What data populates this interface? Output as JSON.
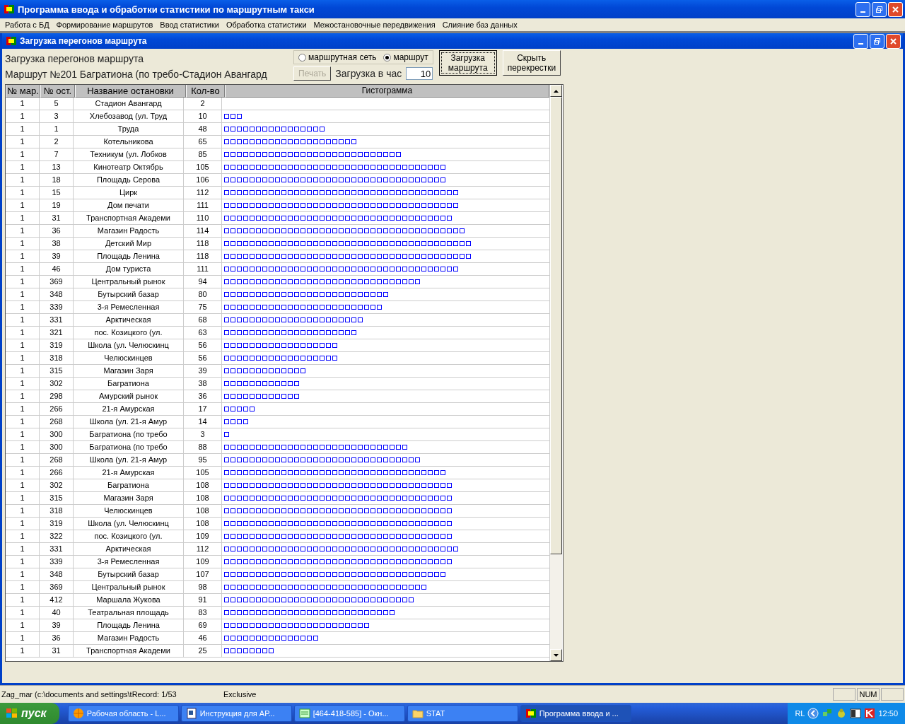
{
  "window": {
    "title": "Программа ввода и обработки статистики по маршрутным такси"
  },
  "menu": [
    "Работа с БД",
    "Формирование маршрутов",
    "Ввод статистики",
    "Обработка статистики",
    "Межостановочные передвижения",
    "Слияние баз данных"
  ],
  "child_window": {
    "title": "Загрузка перегонов маршрута"
  },
  "panel": {
    "heading": "Загрузка перегонов маршрута",
    "route_caption": "Маршрут №201  Багратиона (по требо-Стадион Авангард",
    "radios": [
      {
        "label": "маршрутная сеть",
        "selected": false
      },
      {
        "label": "маршрут",
        "selected": true
      }
    ],
    "print_button": {
      "label": "Печать",
      "disabled": true
    },
    "load_per_hour": {
      "label": "Загрузка в час",
      "value": "10"
    },
    "buttons": [
      {
        "label": "Загрузка маршрута",
        "focused": true
      },
      {
        "label": "Скрыть перекрестки",
        "focused": false
      }
    ]
  },
  "table": {
    "columns": [
      "№ мар.",
      "№ ост.",
      "Название остановки",
      "Кол-во",
      "Гистограмма"
    ],
    "rows": [
      {
        "route": "1",
        "stop": "5",
        "name": "Стадион Авангард",
        "count": "2"
      },
      {
        "route": "1",
        "stop": "3",
        "name": "Хлебозавод (ул. Труд",
        "count": "10"
      },
      {
        "route": "1",
        "stop": "1",
        "name": "Труда",
        "count": "48"
      },
      {
        "route": "1",
        "stop": "2",
        "name": "Котельникова",
        "count": "65"
      },
      {
        "route": "1",
        "stop": "7",
        "name": "Техникум (ул. Лобков",
        "count": "85"
      },
      {
        "route": "1",
        "stop": "13",
        "name": "Кинотеатр Октябрь",
        "count": "105"
      },
      {
        "route": "1",
        "stop": "18",
        "name": "Площадь  Серова",
        "count": "106"
      },
      {
        "route": "1",
        "stop": "15",
        "name": "Цирк",
        "count": "112"
      },
      {
        "route": "1",
        "stop": "19",
        "name": "Дом печати",
        "count": "111"
      },
      {
        "route": "1",
        "stop": "31",
        "name": "Транспортная Академи",
        "count": "110"
      },
      {
        "route": "1",
        "stop": "36",
        "name": "Магазин Радость",
        "count": "114"
      },
      {
        "route": "1",
        "stop": "38",
        "name": "Детский Мир",
        "count": "118"
      },
      {
        "route": "1",
        "stop": "39",
        "name": "Площадь Ленина",
        "count": "118"
      },
      {
        "route": "1",
        "stop": "46",
        "name": "Дом туриста",
        "count": "111"
      },
      {
        "route": "1",
        "stop": "369",
        "name": "Центральный рынок",
        "count": "94"
      },
      {
        "route": "1",
        "stop": "348",
        "name": "Бутырский базар",
        "count": "80"
      },
      {
        "route": "1",
        "stop": "339",
        "name": "3-я Ремесленная",
        "count": "75"
      },
      {
        "route": "1",
        "stop": "331",
        "name": "Арктическая",
        "count": "68"
      },
      {
        "route": "1",
        "stop": "321",
        "name": "пос. Козицкого (ул.",
        "count": "63"
      },
      {
        "route": "1",
        "stop": "319",
        "name": "Школа (ул. Челюскинц",
        "count": "56"
      },
      {
        "route": "1",
        "stop": "318",
        "name": "Челюскинцев",
        "count": "56"
      },
      {
        "route": "1",
        "stop": "315",
        "name": "Магазин Заря",
        "count": "39"
      },
      {
        "route": "1",
        "stop": "302",
        "name": "Багратиона",
        "count": "38"
      },
      {
        "route": "1",
        "stop": "298",
        "name": "Амурский рынок",
        "count": "36"
      },
      {
        "route": "1",
        "stop": "266",
        "name": "21-я Амурская",
        "count": "17"
      },
      {
        "route": "1",
        "stop": "268",
        "name": "Школа (ул. 21-я Амур",
        "count": "14"
      },
      {
        "route": "1",
        "stop": "300",
        "name": "Багратиона (по требо",
        "count": "3"
      },
      {
        "route": "1",
        "stop": "300",
        "name": "Багратиона (по требо",
        "count": "88"
      },
      {
        "route": "1",
        "stop": "268",
        "name": "Школа (ул. 21-я Амур",
        "count": "95"
      },
      {
        "route": "1",
        "stop": "266",
        "name": "21-я Амурская",
        "count": "105"
      },
      {
        "route": "1",
        "stop": "302",
        "name": "Багратиона",
        "count": "108"
      },
      {
        "route": "1",
        "stop": "315",
        "name": "Магазин Заря",
        "count": "108"
      },
      {
        "route": "1",
        "stop": "318",
        "name": "Челюскинцев",
        "count": "108"
      },
      {
        "route": "1",
        "stop": "319",
        "name": "Школа (ул. Челюскинц",
        "count": "108"
      },
      {
        "route": "1",
        "stop": "322",
        "name": "пос. Козицкого (ул.",
        "count": "109"
      },
      {
        "route": "1",
        "stop": "331",
        "name": "Арктическая",
        "count": "112"
      },
      {
        "route": "1",
        "stop": "339",
        "name": "3-я Ремесленная",
        "count": "109"
      },
      {
        "route": "1",
        "stop": "348",
        "name": "Бутырский базар",
        "count": "107"
      },
      {
        "route": "1",
        "stop": "369",
        "name": "Центральный рынок",
        "count": "98"
      },
      {
        "route": "1",
        "stop": "412",
        "name": "Маршала Жукова",
        "count": "91"
      },
      {
        "route": "1",
        "stop": "40",
        "name": "Театральная площадь",
        "count": "83"
      },
      {
        "route": "1",
        "stop": "39",
        "name": "Площадь Ленина",
        "count": "69"
      },
      {
        "route": "1",
        "stop": "36",
        "name": "Магазин Радость",
        "count": "46"
      },
      {
        "route": "1",
        "stop": "31",
        "name": "Транспортная Академи",
        "count": "25"
      }
    ]
  },
  "status_bar": {
    "file": "Zag_mar (c:\\documents and settings\\tRecord: 1/53",
    "mode": "Exclusive",
    "indicator": "NUM"
  },
  "taskbar": {
    "start": "пуск",
    "tasks": [
      {
        "label": "Рабочая область - L...",
        "selected": false
      },
      {
        "label": "Инструкция для АР...",
        "selected": false
      },
      {
        "label": "[464-418-585] - Окн...",
        "selected": false
      },
      {
        "label": "STAT",
        "selected": false
      },
      {
        "label": "Программа ввода и ...",
        "selected": true
      }
    ],
    "tray": {
      "lang": "RL",
      "time": "12:50"
    }
  }
}
